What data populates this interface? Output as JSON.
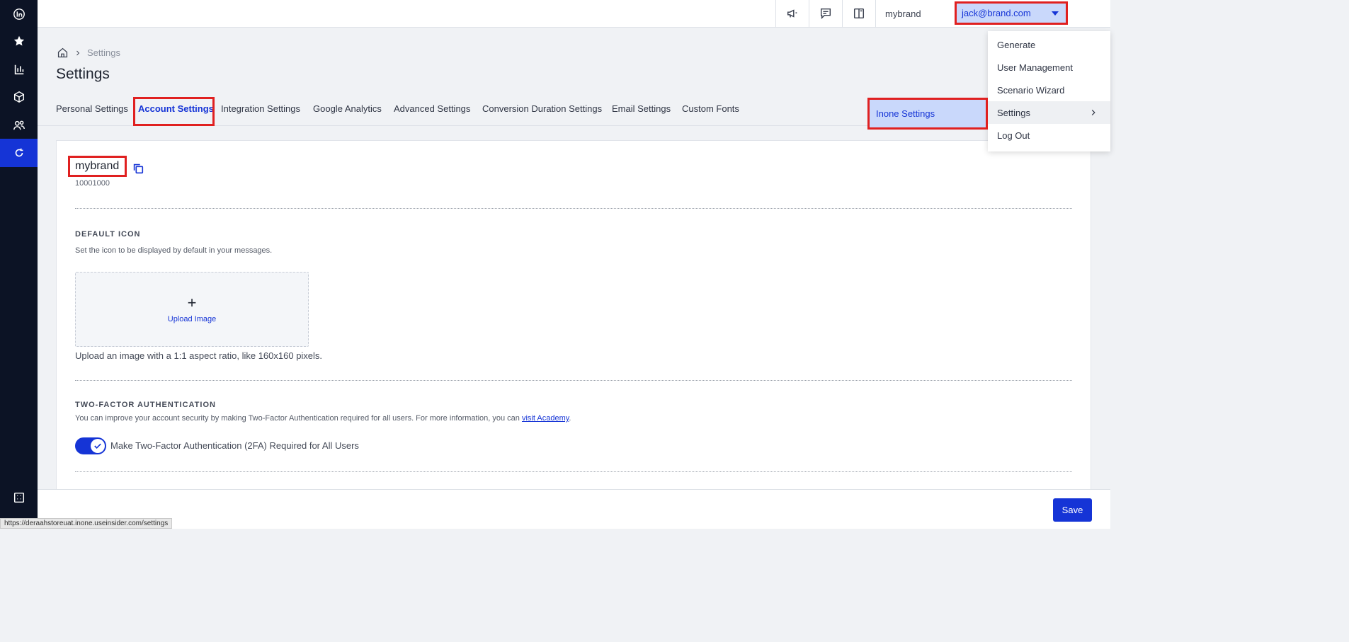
{
  "rail": {
    "items": [
      "insider-logo-icon",
      "star-icon",
      "bar-chart-icon",
      "cube-icon",
      "users-icon",
      "refresh-icon",
      "apps-grid-icon"
    ]
  },
  "topbar": {
    "brand_select": "mybrand",
    "user_select": "jack@brand.com"
  },
  "user_menu": {
    "items": [
      "Generate",
      "User Management",
      "Scenario Wizard",
      "Settings",
      "Log Out"
    ],
    "submenu_item": "Inone Settings"
  },
  "breadcrumb": {
    "current": "Settings"
  },
  "page_title": "Settings",
  "tabs": [
    "Personal Settings",
    "Account Settings",
    "Integration Settings",
    "Google Analytics",
    "Advanced Settings",
    "Conversion Duration Settings",
    "Email Settings",
    "Custom Fonts"
  ],
  "account": {
    "name": "mybrand",
    "id": "10001000"
  },
  "default_icon": {
    "title": "DEFAULT ICON",
    "description": "Set the icon to be displayed by default in your messages.",
    "upload_plus": "+",
    "upload_label": "Upload Image",
    "hint": "Upload an image with a 1:1 aspect ratio, like 160x160 pixels."
  },
  "two_factor": {
    "title": "TWO-FACTOR AUTHENTICATION",
    "description_prefix": "You can improve your account security by making Two-Factor Authentication required for all users. For more information, you can ",
    "link": "visit Academy",
    "description_suffix": ".",
    "toggle_label": "Make Two-Factor Authentication (2FA) Required for All Users",
    "enabled": true
  },
  "footer": {
    "save_label": "Save"
  },
  "status_url": "https://deraahstoreuat.inone.useinsider.com/settings",
  "colors": {
    "accent": "#1534d6",
    "rail": "#0c1325",
    "highlight": "#e02020"
  }
}
